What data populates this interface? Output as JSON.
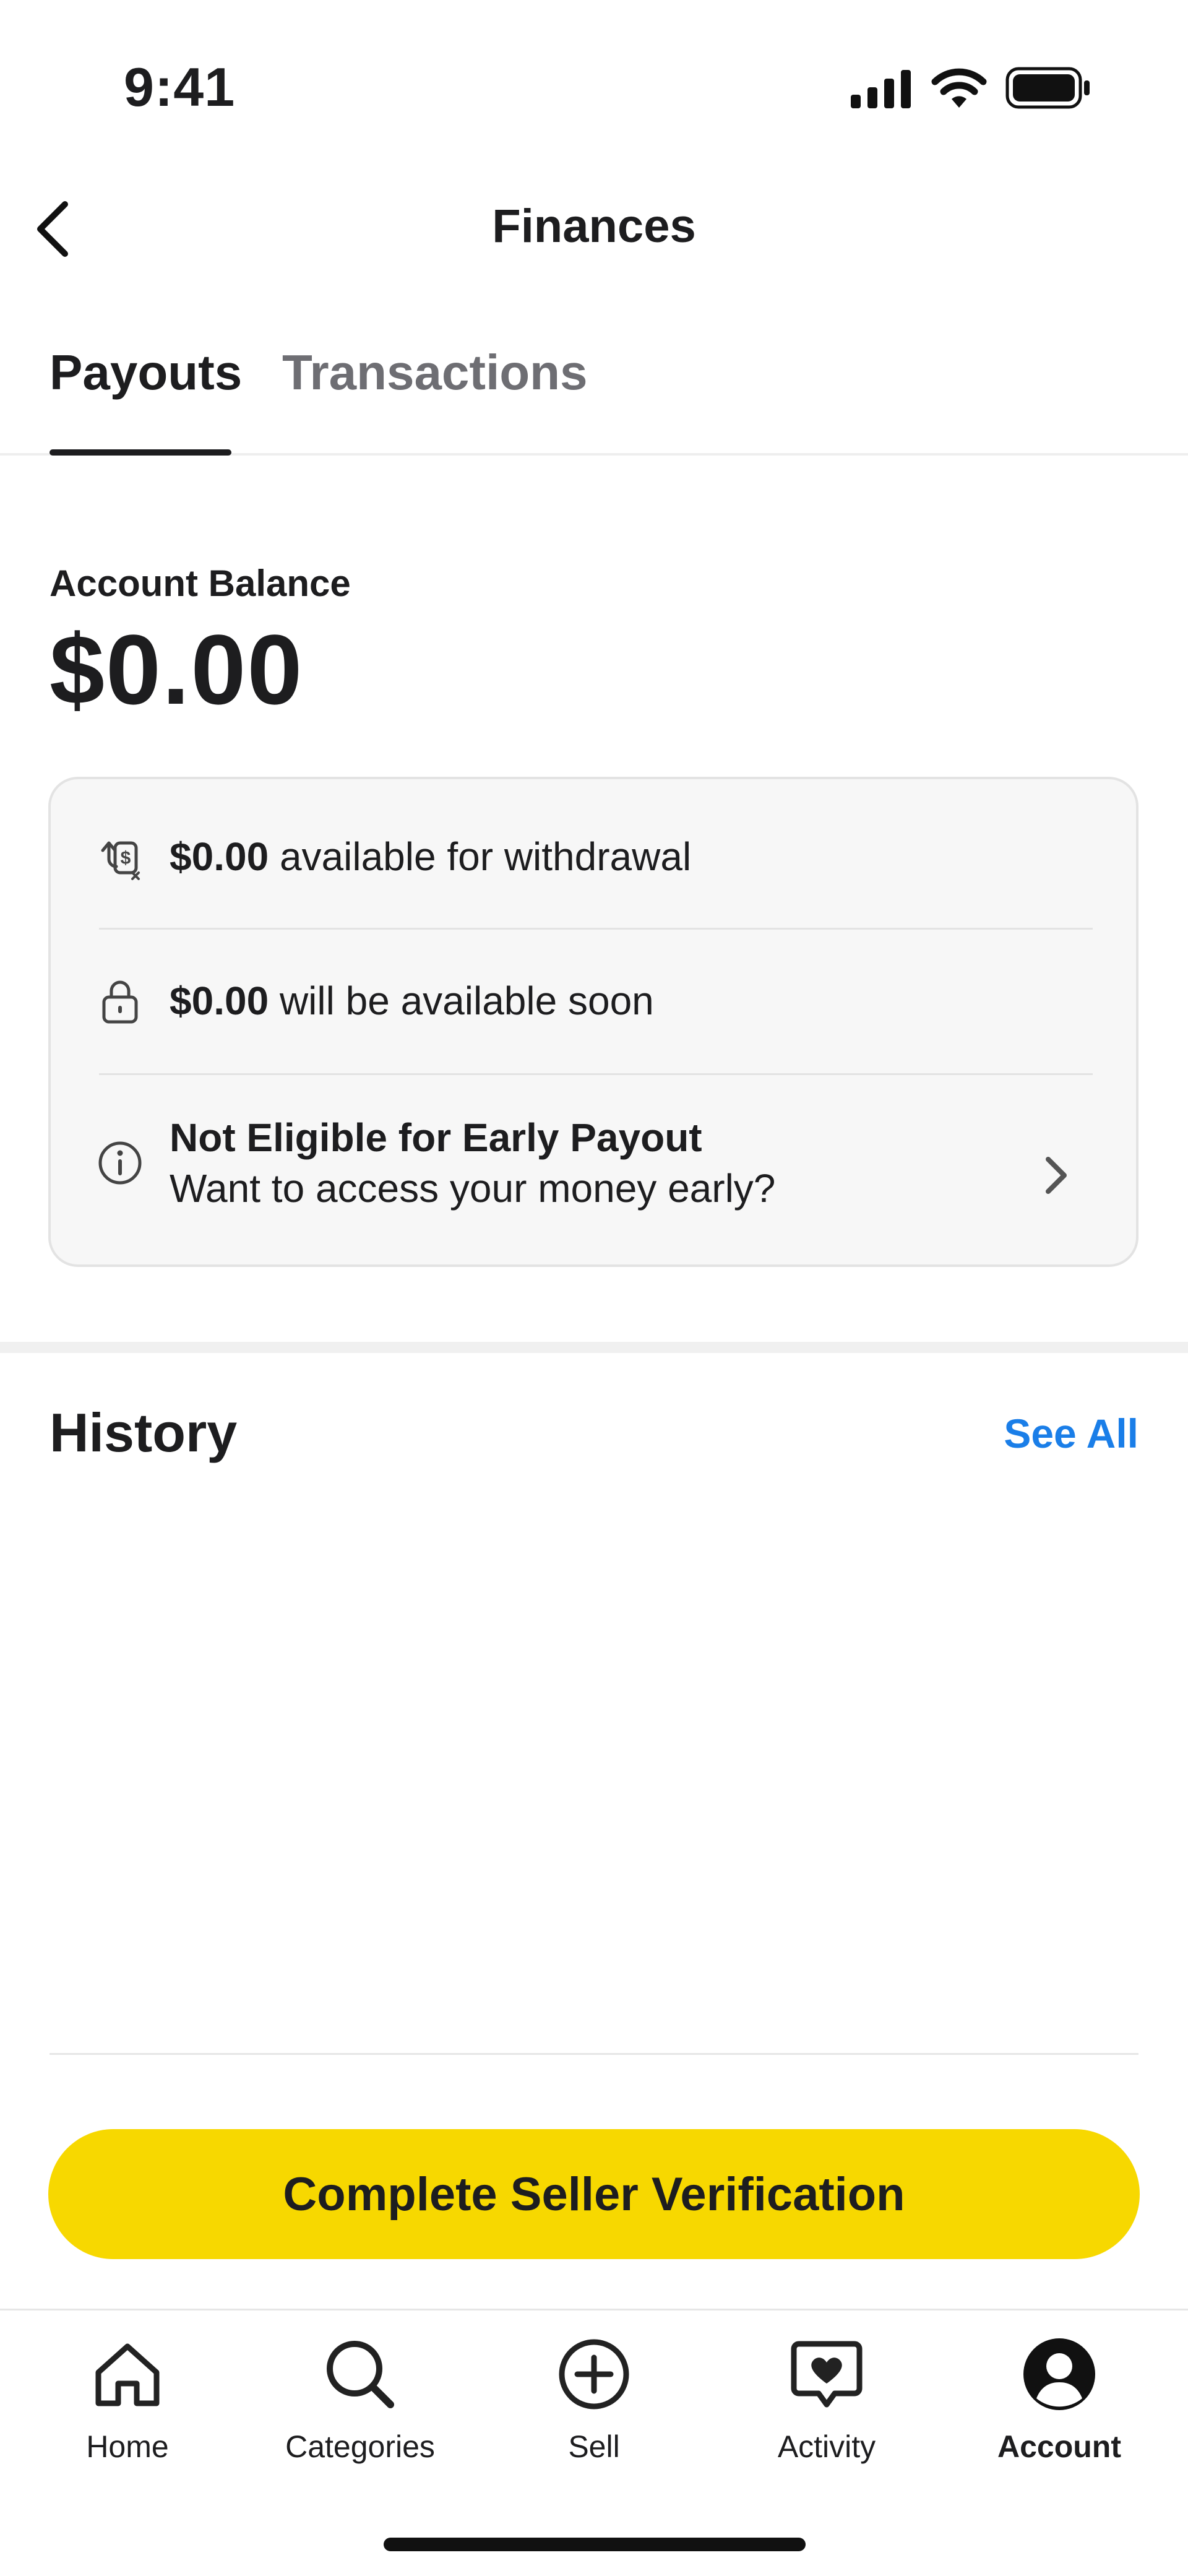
{
  "status_bar": {
    "time": "9:41"
  },
  "header": {
    "title": "Finances"
  },
  "tabs": [
    {
      "label": "Payouts",
      "active": true
    },
    {
      "label": "Transactions",
      "active": false
    }
  ],
  "balance": {
    "label": "Account Balance",
    "amount": "$0.00"
  },
  "card": {
    "rows": [
      {
        "icon": "money-transfer-icon",
        "amount": "$0.00",
        "text": " available for withdrawal"
      },
      {
        "icon": "lock-icon",
        "amount": "$0.00",
        "text": " will be available soon"
      },
      {
        "icon": "info-icon",
        "title": "Not Eligible for Early Payout",
        "subtitle": "Want to access your money early?"
      }
    ]
  },
  "history": {
    "title": "History",
    "see_all": "See All"
  },
  "cta": {
    "label": "Complete Seller Verification"
  },
  "bottom_nav": [
    {
      "label": "Home",
      "icon": "home-icon",
      "active": false
    },
    {
      "label": "Categories",
      "icon": "search-icon",
      "active": false
    },
    {
      "label": "Sell",
      "icon": "plus-circle-icon",
      "active": false
    },
    {
      "label": "Activity",
      "icon": "heart-chat-icon",
      "active": false
    },
    {
      "label": "Account",
      "icon": "account-icon",
      "active": true
    }
  ],
  "colors": {
    "accent_yellow": "#f7d800",
    "link_blue": "#1a7ee8",
    "text": "#1d1d1f",
    "muted": "#6e6e73"
  }
}
